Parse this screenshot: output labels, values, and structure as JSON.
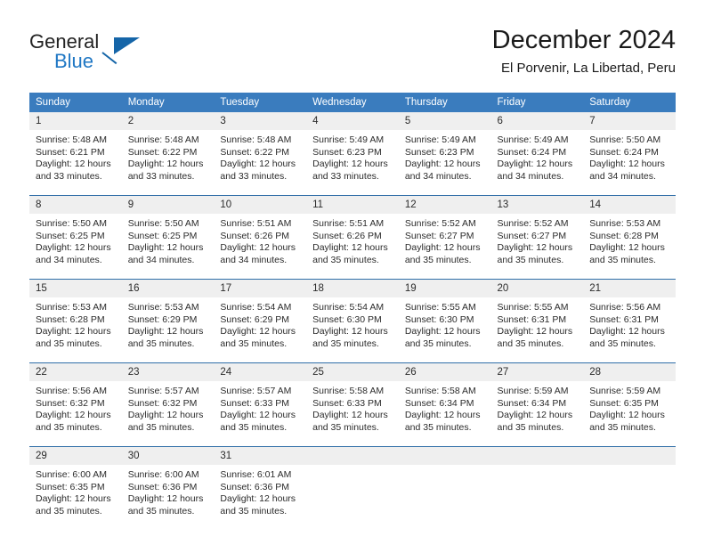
{
  "brand": {
    "name_part1": "General",
    "name_part2": "Blue",
    "logo_icon": "triangle-logo-icon"
  },
  "header": {
    "title": "December 2024",
    "subtitle": "El Porvenir, La Libertad, Peru"
  },
  "calendar": {
    "weekday_headers": [
      "Sunday",
      "Monday",
      "Tuesday",
      "Wednesday",
      "Thursday",
      "Friday",
      "Saturday"
    ],
    "accent_color": "#3a7cbe",
    "row_border_color": "#2f6ea8",
    "daynum_bg_color": "#efefef",
    "weeks": [
      [
        {
          "day": "1",
          "sunrise": "Sunrise: 5:48 AM",
          "sunset": "Sunset: 6:21 PM",
          "daylight_line1": "Daylight: 12 hours",
          "daylight_line2": "and 33 minutes."
        },
        {
          "day": "2",
          "sunrise": "Sunrise: 5:48 AM",
          "sunset": "Sunset: 6:22 PM",
          "daylight_line1": "Daylight: 12 hours",
          "daylight_line2": "and 33 minutes."
        },
        {
          "day": "3",
          "sunrise": "Sunrise: 5:48 AM",
          "sunset": "Sunset: 6:22 PM",
          "daylight_line1": "Daylight: 12 hours",
          "daylight_line2": "and 33 minutes."
        },
        {
          "day": "4",
          "sunrise": "Sunrise: 5:49 AM",
          "sunset": "Sunset: 6:23 PM",
          "daylight_line1": "Daylight: 12 hours",
          "daylight_line2": "and 33 minutes."
        },
        {
          "day": "5",
          "sunrise": "Sunrise: 5:49 AM",
          "sunset": "Sunset: 6:23 PM",
          "daylight_line1": "Daylight: 12 hours",
          "daylight_line2": "and 34 minutes."
        },
        {
          "day": "6",
          "sunrise": "Sunrise: 5:49 AM",
          "sunset": "Sunset: 6:24 PM",
          "daylight_line1": "Daylight: 12 hours",
          "daylight_line2": "and 34 minutes."
        },
        {
          "day": "7",
          "sunrise": "Sunrise: 5:50 AM",
          "sunset": "Sunset: 6:24 PM",
          "daylight_line1": "Daylight: 12 hours",
          "daylight_line2": "and 34 minutes."
        }
      ],
      [
        {
          "day": "8",
          "sunrise": "Sunrise: 5:50 AM",
          "sunset": "Sunset: 6:25 PM",
          "daylight_line1": "Daylight: 12 hours",
          "daylight_line2": "and 34 minutes."
        },
        {
          "day": "9",
          "sunrise": "Sunrise: 5:50 AM",
          "sunset": "Sunset: 6:25 PM",
          "daylight_line1": "Daylight: 12 hours",
          "daylight_line2": "and 34 minutes."
        },
        {
          "day": "10",
          "sunrise": "Sunrise: 5:51 AM",
          "sunset": "Sunset: 6:26 PM",
          "daylight_line1": "Daylight: 12 hours",
          "daylight_line2": "and 34 minutes."
        },
        {
          "day": "11",
          "sunrise": "Sunrise: 5:51 AM",
          "sunset": "Sunset: 6:26 PM",
          "daylight_line1": "Daylight: 12 hours",
          "daylight_line2": "and 35 minutes."
        },
        {
          "day": "12",
          "sunrise": "Sunrise: 5:52 AM",
          "sunset": "Sunset: 6:27 PM",
          "daylight_line1": "Daylight: 12 hours",
          "daylight_line2": "and 35 minutes."
        },
        {
          "day": "13",
          "sunrise": "Sunrise: 5:52 AM",
          "sunset": "Sunset: 6:27 PM",
          "daylight_line1": "Daylight: 12 hours",
          "daylight_line2": "and 35 minutes."
        },
        {
          "day": "14",
          "sunrise": "Sunrise: 5:53 AM",
          "sunset": "Sunset: 6:28 PM",
          "daylight_line1": "Daylight: 12 hours",
          "daylight_line2": "and 35 minutes."
        }
      ],
      [
        {
          "day": "15",
          "sunrise": "Sunrise: 5:53 AM",
          "sunset": "Sunset: 6:28 PM",
          "daylight_line1": "Daylight: 12 hours",
          "daylight_line2": "and 35 minutes."
        },
        {
          "day": "16",
          "sunrise": "Sunrise: 5:53 AM",
          "sunset": "Sunset: 6:29 PM",
          "daylight_line1": "Daylight: 12 hours",
          "daylight_line2": "and 35 minutes."
        },
        {
          "day": "17",
          "sunrise": "Sunrise: 5:54 AM",
          "sunset": "Sunset: 6:29 PM",
          "daylight_line1": "Daylight: 12 hours",
          "daylight_line2": "and 35 minutes."
        },
        {
          "day": "18",
          "sunrise": "Sunrise: 5:54 AM",
          "sunset": "Sunset: 6:30 PM",
          "daylight_line1": "Daylight: 12 hours",
          "daylight_line2": "and 35 minutes."
        },
        {
          "day": "19",
          "sunrise": "Sunrise: 5:55 AM",
          "sunset": "Sunset: 6:30 PM",
          "daylight_line1": "Daylight: 12 hours",
          "daylight_line2": "and 35 minutes."
        },
        {
          "day": "20",
          "sunrise": "Sunrise: 5:55 AM",
          "sunset": "Sunset: 6:31 PM",
          "daylight_line1": "Daylight: 12 hours",
          "daylight_line2": "and 35 minutes."
        },
        {
          "day": "21",
          "sunrise": "Sunrise: 5:56 AM",
          "sunset": "Sunset: 6:31 PM",
          "daylight_line1": "Daylight: 12 hours",
          "daylight_line2": "and 35 minutes."
        }
      ],
      [
        {
          "day": "22",
          "sunrise": "Sunrise: 5:56 AM",
          "sunset": "Sunset: 6:32 PM",
          "daylight_line1": "Daylight: 12 hours",
          "daylight_line2": "and 35 minutes."
        },
        {
          "day": "23",
          "sunrise": "Sunrise: 5:57 AM",
          "sunset": "Sunset: 6:32 PM",
          "daylight_line1": "Daylight: 12 hours",
          "daylight_line2": "and 35 minutes."
        },
        {
          "day": "24",
          "sunrise": "Sunrise: 5:57 AM",
          "sunset": "Sunset: 6:33 PM",
          "daylight_line1": "Daylight: 12 hours",
          "daylight_line2": "and 35 minutes."
        },
        {
          "day": "25",
          "sunrise": "Sunrise: 5:58 AM",
          "sunset": "Sunset: 6:33 PM",
          "daylight_line1": "Daylight: 12 hours",
          "daylight_line2": "and 35 minutes."
        },
        {
          "day": "26",
          "sunrise": "Sunrise: 5:58 AM",
          "sunset": "Sunset: 6:34 PM",
          "daylight_line1": "Daylight: 12 hours",
          "daylight_line2": "and 35 minutes."
        },
        {
          "day": "27",
          "sunrise": "Sunrise: 5:59 AM",
          "sunset": "Sunset: 6:34 PM",
          "daylight_line1": "Daylight: 12 hours",
          "daylight_line2": "and 35 minutes."
        },
        {
          "day": "28",
          "sunrise": "Sunrise: 5:59 AM",
          "sunset": "Sunset: 6:35 PM",
          "daylight_line1": "Daylight: 12 hours",
          "daylight_line2": "and 35 minutes."
        }
      ],
      [
        {
          "day": "29",
          "sunrise": "Sunrise: 6:00 AM",
          "sunset": "Sunset: 6:35 PM",
          "daylight_line1": "Daylight: 12 hours",
          "daylight_line2": "and 35 minutes."
        },
        {
          "day": "30",
          "sunrise": "Sunrise: 6:00 AM",
          "sunset": "Sunset: 6:36 PM",
          "daylight_line1": "Daylight: 12 hours",
          "daylight_line2": "and 35 minutes."
        },
        {
          "day": "31",
          "sunrise": "Sunrise: 6:01 AM",
          "sunset": "Sunset: 6:36 PM",
          "daylight_line1": "Daylight: 12 hours",
          "daylight_line2": "and 35 minutes."
        },
        {
          "day": "",
          "sunrise": "",
          "sunset": "",
          "daylight_line1": "",
          "daylight_line2": ""
        },
        {
          "day": "",
          "sunrise": "",
          "sunset": "",
          "daylight_line1": "",
          "daylight_line2": ""
        },
        {
          "day": "",
          "sunrise": "",
          "sunset": "",
          "daylight_line1": "",
          "daylight_line2": ""
        },
        {
          "day": "",
          "sunrise": "",
          "sunset": "",
          "daylight_line1": "",
          "daylight_line2": ""
        }
      ]
    ]
  }
}
